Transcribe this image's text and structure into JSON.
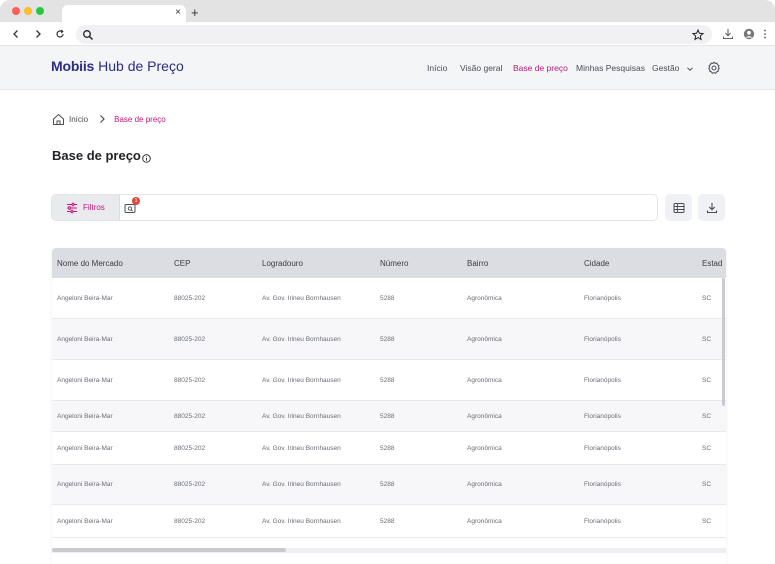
{
  "browser": {
    "tab_close": "×",
    "tab_new": "+"
  },
  "header": {
    "logo_brand": "Mobiis",
    "logo_rest": "Hub de Preço",
    "brand_color": "#2b2d83",
    "accent_color": "#c2187a",
    "menu": [
      {
        "label": "Início"
      },
      {
        "label": "Visão geral"
      },
      {
        "label": "Base de preço"
      },
      {
        "label": "Minhas Pesquisas"
      },
      {
        "label": "Gestão"
      }
    ]
  },
  "breadcrumb": {
    "home": "Início",
    "current": "Base de preço"
  },
  "page": {
    "title": "Base de preço"
  },
  "filters": {
    "label": "Filtros",
    "badge_count": "1"
  },
  "table": {
    "columns": [
      "Nome do Mercado",
      "CEP",
      "Logradouro",
      "Número",
      "Bairro",
      "Cidade",
      "Estado"
    ],
    "visible_last_column_header": "Estad",
    "rows": [
      [
        "Angeloni Beira-Mar",
        "88025-202",
        "Av. Gov. Irineu Bornhausen",
        "5288",
        "Agronômica",
        "Florianópolis",
        "SC"
      ],
      [
        "Angeloni Beira-Mar",
        "88025-202",
        "Av. Gov. Irineu Bornhausen",
        "5288",
        "Agronômica",
        "Florianópolis",
        "SC"
      ],
      [
        "Angeloni Beira-Mar",
        "88025-202",
        "Av. Gov. Irineu Bornhausen",
        "5288",
        "Agronômica",
        "Florianópolis",
        "SC"
      ],
      [
        "Angeloni Beira-Mar",
        "88025-202",
        "Av. Gov. Irineu Bornhausen",
        "5288",
        "Agronômica",
        "Florianópolis",
        "SC"
      ],
      [
        "Angeloni Beira-Mar",
        "88025-202",
        "Av. Gov. Irineu Bornhausen",
        "5288",
        "Agronômica",
        "Florianópolis",
        "SC"
      ],
      [
        "Angeloni Beira-Mar",
        "88025-202",
        "Av. Gov. Irineu Bornhausen",
        "5288",
        "Agronômica",
        "Florianópolis",
        "SC"
      ],
      [
        "Angeloni Beira-Mar",
        "88025-202",
        "Av. Gov. Irineu Bornhausen",
        "5288",
        "Agronômica",
        "Florianópolis",
        "SC"
      ]
    ]
  }
}
